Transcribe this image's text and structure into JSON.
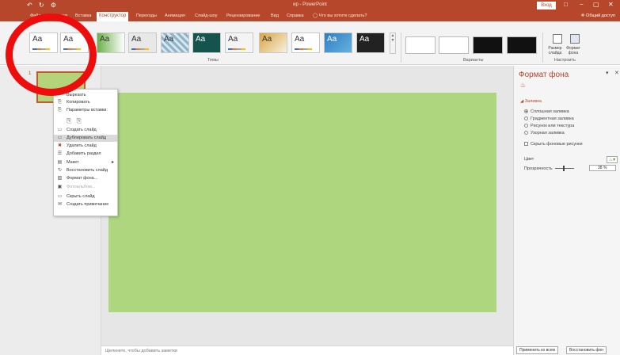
{
  "app": {
    "qat_icons": "↶ ↻ ⚙",
    "title": "ир - PowerPoint",
    "login_label": "Вход",
    "window_controls": [
      "□",
      "−",
      "▢",
      "✕"
    ],
    "accent_color": "#b7472a"
  },
  "tabs": [
    {
      "label": "Файл"
    },
    {
      "label": "Главная"
    },
    {
      "label": "Вставка"
    },
    {
      "label": "Конструктор",
      "active": true
    },
    {
      "label": "Переходы"
    },
    {
      "label": "Анимация"
    },
    {
      "label": "Слайд-шоу"
    },
    {
      "label": "Рецензирование"
    },
    {
      "label": "Вид"
    },
    {
      "label": "Справка"
    },
    {
      "label": "◯ Что вы хотите сделать?"
    }
  ],
  "share_label": "⎆ Общий доступ",
  "ribbon": {
    "themes_group_label": "Темы",
    "variants_group_label": "Варианты",
    "customize_group_label": "Настроить",
    "theme_sample_text": "Aa",
    "slide_size_label": "Размер слайда",
    "format_bg_label": "Формат фона"
  },
  "slides": [
    {
      "number": "1",
      "background_color": "#b3d47a"
    }
  ],
  "main_slide": {
    "background_color": "#add67f"
  },
  "notes_placeholder": "Щелкните, чтобы добавить заметки",
  "context_menu": {
    "items": [
      {
        "label": "Вырезать",
        "icon": "scissors-icon",
        "glyph": "✂"
      },
      {
        "label": "Копировать",
        "icon": "copy-icon",
        "glyph": "⎘"
      },
      {
        "label": "Параметры вставки:",
        "icon": "paste-icon",
        "glyph": "⎘"
      },
      {
        "label": "Создать слайд",
        "icon": "new-slide-icon",
        "glyph": "▭"
      },
      {
        "label": "Дублировать слайд",
        "icon": "duplicate-slide-icon",
        "glyph": "▭",
        "highlighted": true
      },
      {
        "label": "Удалить слайд",
        "icon": "delete-slide-icon",
        "glyph": "✖"
      },
      {
        "label": "Добавить раздел",
        "icon": "section-icon",
        "glyph": "☰"
      },
      {
        "label": "Макет",
        "icon": "layout-icon",
        "glyph": "▤",
        "submenu": true
      },
      {
        "label": "Восстановить слайд",
        "icon": "reset-slide-icon",
        "glyph": "↻"
      },
      {
        "label": "Формат фона...",
        "icon": "format-bg-icon",
        "glyph": "▨"
      },
      {
        "label": "Фотоальбом...",
        "icon": "photo-album-icon",
        "glyph": "▣",
        "disabled": true
      },
      {
        "label": "Скрыть слайд",
        "icon": "hide-slide-icon",
        "glyph": "▭"
      },
      {
        "label": "Создать примечание",
        "icon": "comment-icon",
        "glyph": "✉"
      }
    ],
    "paste_option_icons": "⎘ ⎘"
  },
  "format_pane": {
    "title": "Формат фона",
    "section": "◢ Заливка",
    "options": [
      {
        "label": "Сплошная заливка",
        "selected": true
      },
      {
        "label": "Градиентная заливка",
        "selected": false
      },
      {
        "label": "Рисунок или текстура",
        "selected": false
      },
      {
        "label": "Узорная заливка",
        "selected": false
      }
    ],
    "hide_graphics_label": "Скрыть фоновые рисунки",
    "color_label": "Цвет",
    "transparency_label": "Прозрачность",
    "transparency_value": "38 %",
    "transparency_fraction": 0.38,
    "apply_all_label": "Применить ко всем",
    "reset_bg_label": "Восстановить фон"
  },
  "annotation_color": "#ee0d0d"
}
